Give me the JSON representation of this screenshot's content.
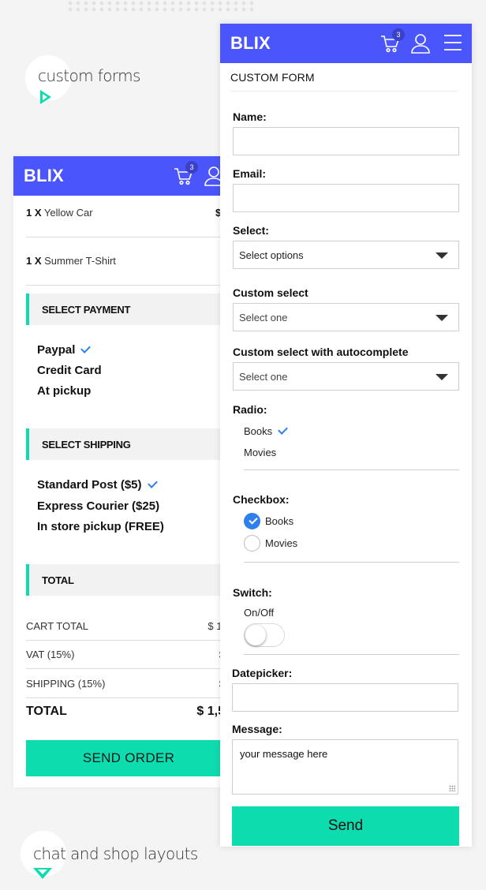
{
  "labels": {
    "custom_forms": "custom forms",
    "chat_shop": "chat and shop layouts"
  },
  "left": {
    "brand": "BLIX",
    "cart_badge": "3",
    "cart_items": [
      {
        "qty": "1 X",
        "name": "Yellow Car",
        "price": "$"
      },
      {
        "qty": "1 X",
        "name": "Summer T-Shirt"
      }
    ],
    "payment_heading": "SELECT PAYMENT",
    "payment_options": [
      "Paypal",
      "Credit Card",
      "At pickup"
    ],
    "shipping_heading": "SELECT SHIPPING",
    "shipping_options": [
      "Standard Post ($5)",
      "Express Courier ($25)",
      "In store pickup (FREE)"
    ],
    "total_heading": "TOTAL",
    "totals": [
      {
        "label": "CART TOTAL",
        "value": "$ 1,"
      },
      {
        "label": "VAT (15%)",
        "value": "$"
      },
      {
        "label": "SHIPPING (15%)",
        "value": "$"
      },
      {
        "label": "TOTAL",
        "value": "$ 1,5"
      }
    ],
    "send_order": "SEND ORDER"
  },
  "right": {
    "brand": "BLIX",
    "cart_badge": "3",
    "form_title": "CUSTOM FORM",
    "name_label": "Name:",
    "email_label": "Email:",
    "select_label": "Select:",
    "select_value": "Select options",
    "custom_select_label": "Custom select",
    "custom_select_value": "Select one",
    "autocomplete_label": "Custom select with autocomplete",
    "autocomplete_value": "Select one",
    "radio_label": "Radio:",
    "radio_options": [
      "Books",
      "Movies"
    ],
    "checkbox_label": "Checkbox:",
    "checkbox_options": [
      "Books",
      "Movies"
    ],
    "switch_label": "Switch:",
    "switch_text": "On/Off",
    "datepicker_label": "Datepicker:",
    "message_label": "Message:",
    "message_value": "your message here",
    "send": "Send"
  }
}
